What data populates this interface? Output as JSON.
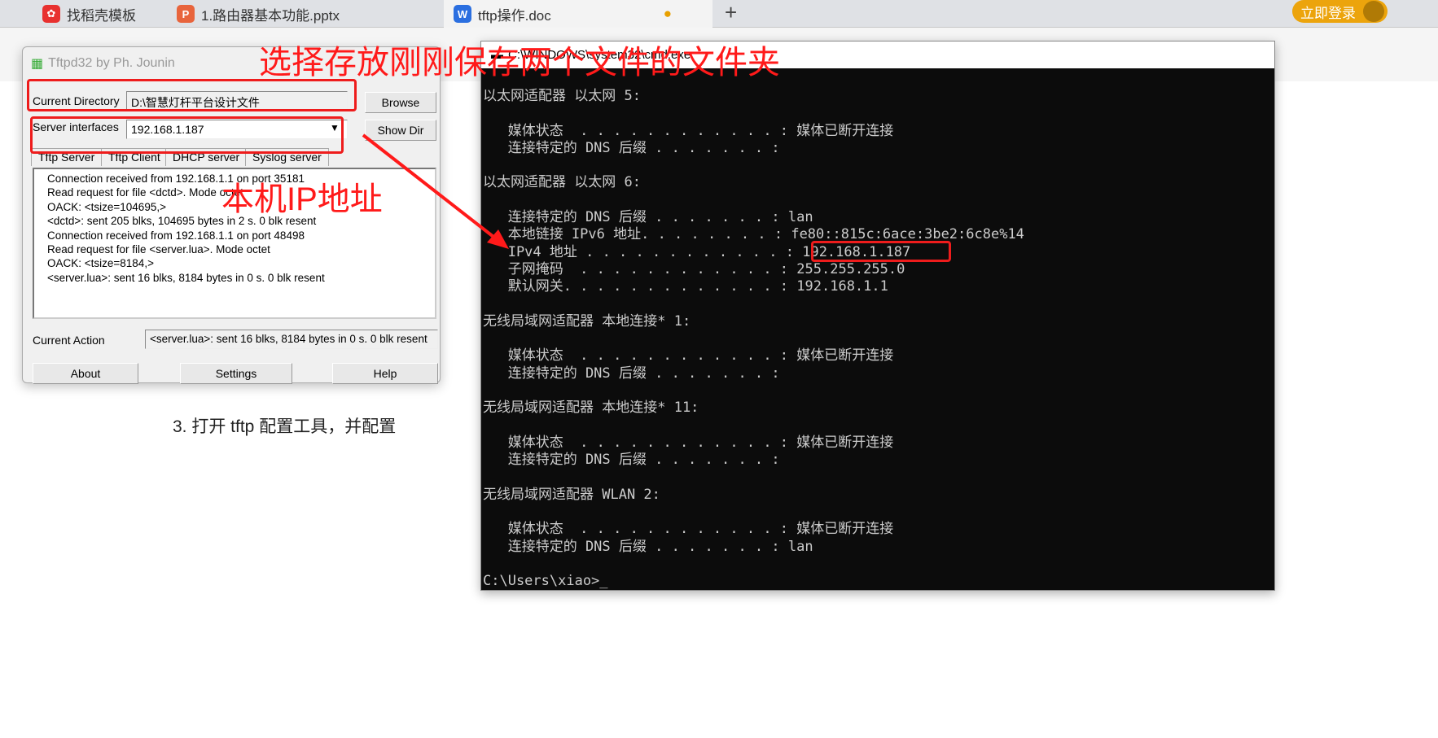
{
  "browser_tabs": [
    {
      "label": "找稻壳模板",
      "icon": "docer-icon",
      "color": "#e8312f"
    },
    {
      "label": "1.路由器基本功能.pptx",
      "icon": "ppt-icon",
      "color": "#e8643c"
    },
    {
      "label": "tftp操作.doc",
      "icon": "word-icon",
      "color": "#2b6fe0",
      "active": true
    }
  ],
  "login_button": "立即登录",
  "doc": {
    "step_text": "3.  打开 tftp 配置工具，并配置"
  },
  "tftpd": {
    "title": "Tftpd32 by Ph. Jounin",
    "current_directory_label": "Current Directory",
    "current_directory_value": "D:\\智慧灯杆平台设计文件",
    "server_interfaces_label": "Server interfaces",
    "server_interfaces_value": "192.168.1.187",
    "browse": "Browse",
    "show_dir": "Show Dir",
    "tabs": [
      "Tftp Server",
      "Tftp Client",
      "DHCP server",
      "Syslog server"
    ],
    "log": [
      "Connection received from 192.168.1.1 on port 35181",
      "Read request for file <dctd>. Mode octet",
      "OACK: <tsize=104695,>",
      "<dctd>: sent 205 blks, 104695 bytes in 2 s. 0 blk resent",
      "Connection received from 192.168.1.1 on port 48498",
      "Read request for file <server.lua>. Mode octet",
      "OACK: <tsize=8184,>",
      "<server.lua>: sent 16 blks, 8184 bytes in 0 s. 0 blk resent"
    ],
    "current_action_label": "Current Action",
    "current_action_value": "<server.lua>: sent 16 blks, 8184 bytes in 0 s. 0 blk resent",
    "about": "About",
    "settings": "Settings",
    "help": "Help"
  },
  "cmd": {
    "title": "C:\\WINDOWS\\system32\\cmd.exe",
    "lines": [
      "以太网适配器 以太网 5:",
      "",
      "   媒体状态  . . . . . . . . . . . . : 媒体已断开连接",
      "   连接特定的 DNS 后缀 . . . . . . . :",
      "",
      "以太网适配器 以太网 6:",
      "",
      "   连接特定的 DNS 后缀 . . . . . . . : lan",
      "   本地链接 IPv6 地址. . . . . . . . : fe80::815c:6ace:3be2:6c8e%14",
      "   IPv4 地址 . . . . . . . . . . . . : 192.168.1.187",
      "   子网掩码  . . . . . . . . . . . . : 255.255.255.0",
      "   默认网关. . . . . . . . . . . . . : 192.168.1.1",
      "",
      "无线局域网适配器 本地连接* 1:",
      "",
      "   媒体状态  . . . . . . . . . . . . : 媒体已断开连接",
      "   连接特定的 DNS 后缀 . . . . . . . :",
      "",
      "无线局域网适配器 本地连接* 11:",
      "",
      "   媒体状态  . . . . . . . . . . . . : 媒体已断开连接",
      "   连接特定的 DNS 后缀 . . . . . . . :",
      "",
      "无线局域网适配器 WLAN 2:",
      "",
      "   媒体状态  . . . . . . . . . . . . : 媒体已断开连接",
      "   连接特定的 DNS 后缀 . . . . . . . : lan",
      "",
      "C:\\Users\\xiao>_"
    ]
  },
  "annotations": {
    "folder_note": "选择存放刚刚保存两个文件的文件夹",
    "ip_note": "本机IP地址",
    "color": "#ff1a1a"
  }
}
